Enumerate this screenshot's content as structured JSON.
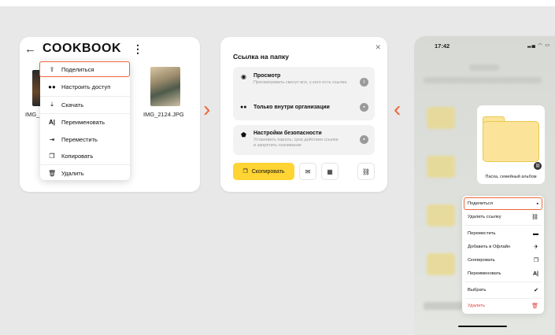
{
  "panel1": {
    "title": "COOKBOOK",
    "back_icon": "arrow-left-icon",
    "more_icon": "kebab-icon",
    "file_left": "IMG_",
    "file_right": "IMG_2124.JPG",
    "menu": [
      {
        "label": "Поделиться",
        "icon": "share-icon"
      },
      {
        "label": "Настроить доступ",
        "icon": "users-icon"
      },
      {
        "label": "Скачать",
        "icon": "download-icon"
      },
      {
        "label": "Переименовать",
        "icon": "rename-icon"
      },
      {
        "label": "Переместить",
        "icon": "move-icon"
      },
      {
        "label": "Копировать",
        "icon": "copy-icon"
      },
      {
        "label": "Удалить",
        "icon": "trash-icon"
      }
    ]
  },
  "panel2": {
    "title": "Ссылка на папку",
    "view_title": "Просмотр",
    "view_sub": "Просматривать смогут все, у кого есть ссылка",
    "org_title": "Только внутри организации",
    "security_title": "Настройки безопасности",
    "security_sub": "Установить пароль, срок действия ссылки и запретить скачивание",
    "copy_label": "Скопировать"
  },
  "panel3": {
    "time": "17:42",
    "album_label": "Пасха, семейный альбом",
    "menu": [
      {
        "label": "Поделиться",
        "icon": "lock-icon"
      },
      {
        "label": "Удалить ссылку",
        "icon": "unlink-icon"
      },
      {
        "label": "Переместить",
        "icon": "move-folder-icon"
      },
      {
        "label": "Добавить в Офлайн",
        "icon": "airplane-icon"
      },
      {
        "label": "Скопировать",
        "icon": "copy-icon"
      },
      {
        "label": "Переименовать",
        "icon": "rename-icon"
      },
      {
        "label": "Выбрать",
        "icon": "check-circle-icon"
      },
      {
        "label": "Удалить",
        "icon": "trash-icon"
      }
    ]
  },
  "colors": {
    "accent": "#f0663a",
    "button_yellow": "#ffd433",
    "danger": "#e0413a",
    "folder": "#fbe49a"
  }
}
